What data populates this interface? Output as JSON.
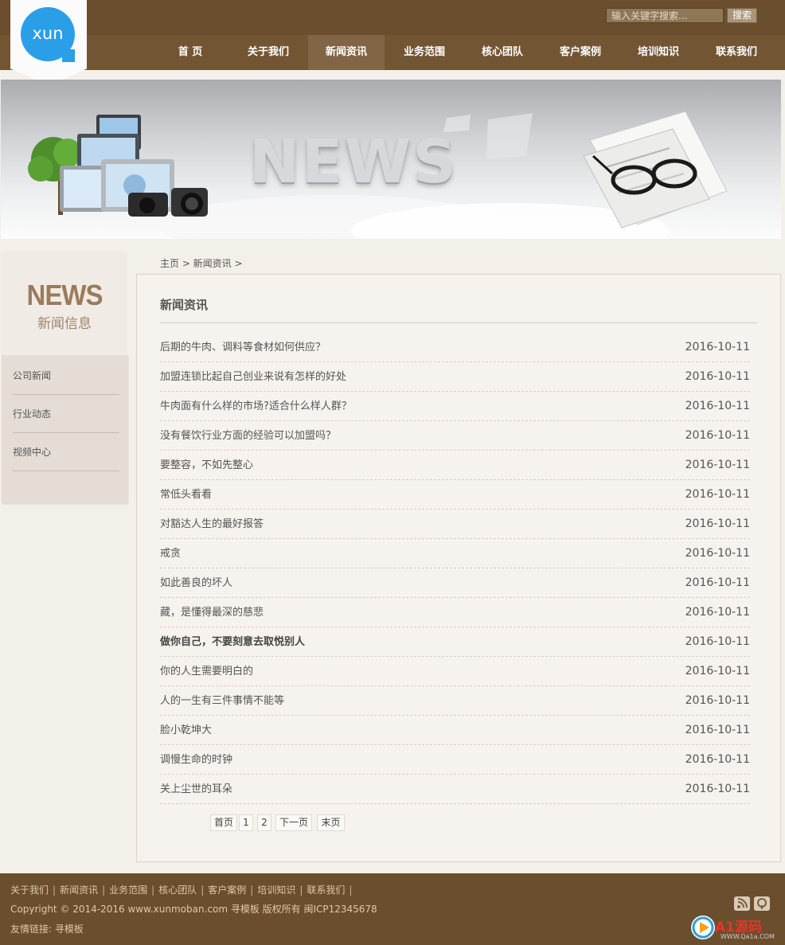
{
  "search": {
    "placeholder": "输入关键字搜索...",
    "button": "搜索"
  },
  "logo": {
    "text": "xun"
  },
  "nav": {
    "items": [
      {
        "label": "首 页"
      },
      {
        "label": "关于我们"
      },
      {
        "label": "新闻资讯"
      },
      {
        "label": "业务范围"
      },
      {
        "label": "核心团队"
      },
      {
        "label": "客户案例"
      },
      {
        "label": "培训知识"
      },
      {
        "label": "联系我们"
      }
    ],
    "active": "新闻资讯"
  },
  "banner": {
    "word": "NEWS"
  },
  "sidebar": {
    "title_en": "NEWS",
    "title_cn": "新闻信息",
    "items": [
      {
        "label": "公司新闻"
      },
      {
        "label": "行业动态"
      },
      {
        "label": "视频中心"
      }
    ]
  },
  "breadcrumb": "主页 > 新闻资讯 >",
  "main": {
    "title": "新闻资讯",
    "news": [
      {
        "title": "后期的牛肉、调料等食材如何供应？",
        "date": "2016-10-11"
      },
      {
        "title": "加盟连锁比起自己创业来说有怎样的好处",
        "date": "2016-10-11"
      },
      {
        "title": "牛肉面有什么样的市场?适合什么样人群？",
        "date": "2016-10-11"
      },
      {
        "title": "没有餐饮行业方面的经验可以加盟吗？",
        "date": "2016-10-11"
      },
      {
        "title": "要整容，不如先整心",
        "date": "2016-10-11"
      },
      {
        "title": "常低头看看",
        "date": "2016-10-11"
      },
      {
        "title": "对豁达人生的最好报答",
        "date": "2016-10-11"
      },
      {
        "title": "戒贪",
        "date": "2016-10-11"
      },
      {
        "title": "如此善良的坏人",
        "date": "2016-10-11"
      },
      {
        "title": "藏，是懂得最深的慈悲",
        "date": "2016-10-11"
      },
      {
        "title": "做你自己，不要刻意去取悦别人",
        "date": "2016-10-11",
        "bold": true
      },
      {
        "title": "你的人生需要明白的",
        "date": "2016-10-11"
      },
      {
        "title": "人的一生有三件事情不能等",
        "date": "2016-10-11"
      },
      {
        "title": "脸小乾坤大",
        "date": "2016-10-11"
      },
      {
        "title": "调慢生命的时钟",
        "date": "2016-10-11"
      },
      {
        "title": "关上尘世的耳朵",
        "date": "2016-10-11"
      }
    ]
  },
  "pager": {
    "first": "首页",
    "p1": "1",
    "p2": "2",
    "next": "下一页",
    "last": "末页"
  },
  "footer": {
    "links": [
      "关于我们",
      "新闻资讯",
      "业务范围",
      "核心团队",
      "客户案例",
      "培训知识",
      "联系我们"
    ],
    "copyright": "Copyright © 2014-2016 www.xunmoban.com 寻模板 版权所有 闽ICP12345678",
    "friend_label": "友情链接:",
    "friend_link": "寻模板"
  },
  "watermark": {
    "brand": "A1源码",
    "url": "WWW.Qa1a.COM"
  },
  "colors": {
    "brown_dark": "#6b4e2e",
    "nav": "#725634",
    "logo_blue": "#2a9fe8",
    "bg": "#f3efe9"
  },
  "icons": [
    "rss-icon",
    "podcast-icon"
  ]
}
